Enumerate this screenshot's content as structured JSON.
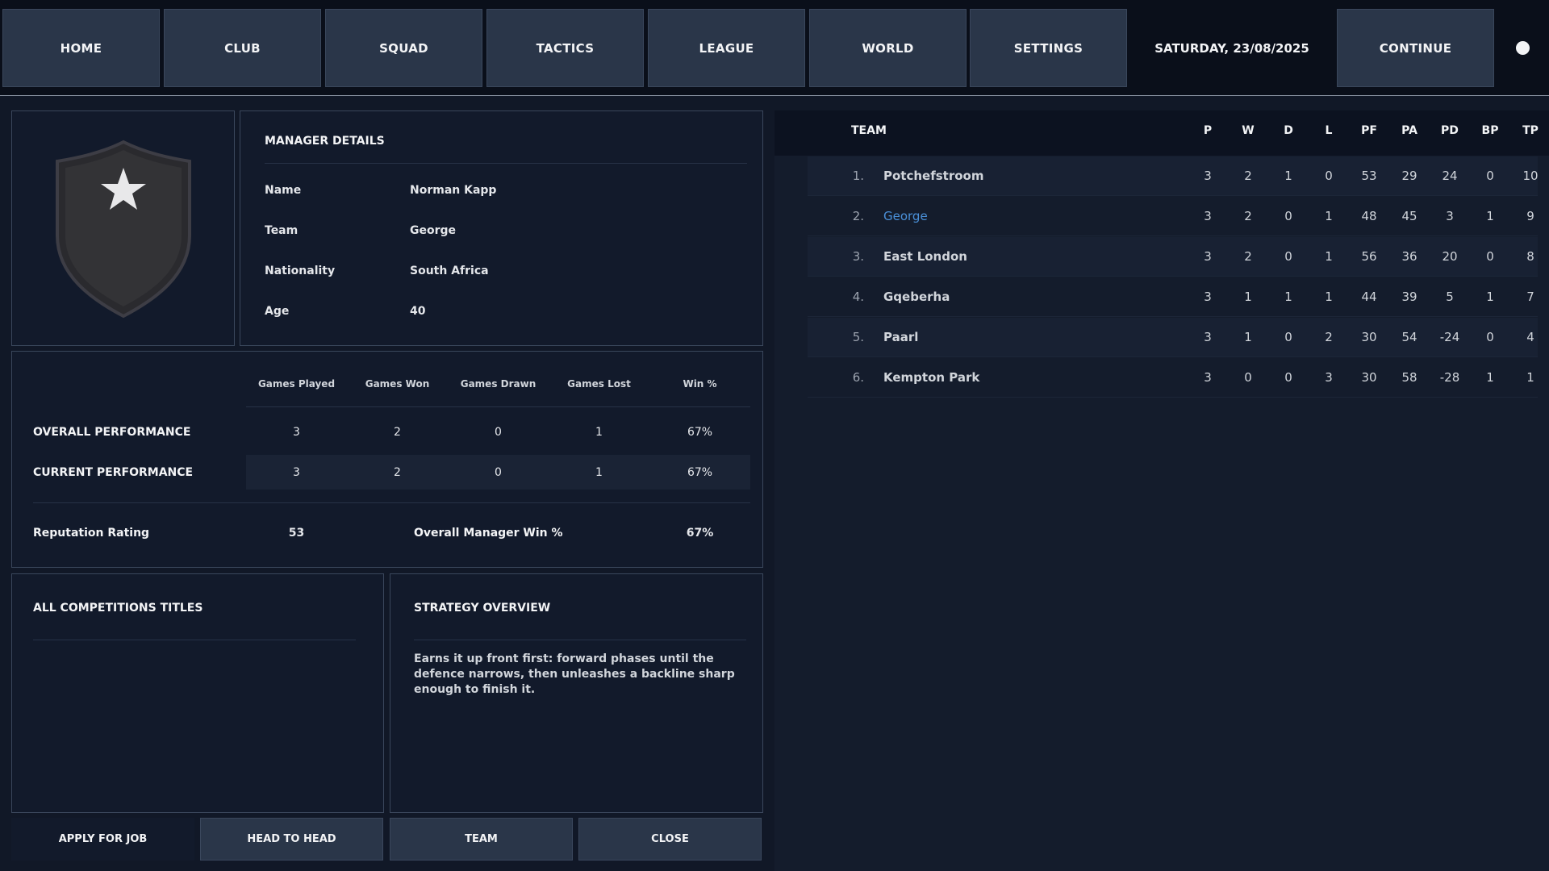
{
  "nav": {
    "items": [
      "HOME",
      "CLUB",
      "SQUAD",
      "TACTICS",
      "LEAGUE",
      "WORLD",
      "SETTINGS"
    ],
    "date": "SATURDAY, 23/08/2025",
    "continue_label": "CONTINUE"
  },
  "manager": {
    "section_title": "MANAGER DETAILS",
    "fields": [
      {
        "key": "Name",
        "value": "Norman Kapp"
      },
      {
        "key": "Team",
        "value": "George"
      },
      {
        "key": "Nationality",
        "value": "South Africa"
      },
      {
        "key": "Age",
        "value": "40"
      }
    ]
  },
  "performance": {
    "columns": [
      "Games Played",
      "Games Won",
      "Games Drawn",
      "Games Lost",
      "Win %"
    ],
    "rows": [
      {
        "label": "OVERALL PERFORMANCE",
        "values": [
          "3",
          "2",
          "0",
          "1",
          "67%"
        ]
      },
      {
        "label": "CURRENT PERFORMANCE",
        "values": [
          "3",
          "2",
          "0",
          "1",
          "67%"
        ]
      }
    ],
    "reputation_label": "Reputation Rating",
    "reputation_value": "53",
    "overall_win_label": "Overall Manager Win %",
    "overall_win_value": "67%"
  },
  "titles": {
    "section_title": "ALL COMPETITIONS TITLES"
  },
  "strategy": {
    "section_title": "STRATEGY OVERVIEW",
    "text": "Earns it up front first: forward phases until the defence narrows, then unleashes a backline sharp enough to finish it."
  },
  "bottom_buttons": {
    "apply": "APPLY FOR JOB",
    "head_to_head": "HEAD TO HEAD",
    "team": "TEAM",
    "close": "CLOSE"
  },
  "league": {
    "team_header": "TEAM",
    "columns": [
      "P",
      "W",
      "D",
      "L",
      "PF",
      "PA",
      "PD",
      "BP",
      "TP"
    ],
    "rows": [
      {
        "pos": "1.",
        "team": "Potchefstroom",
        "stats": [
          "3",
          "2",
          "1",
          "0",
          "53",
          "29",
          "24",
          "0",
          "10"
        ]
      },
      {
        "pos": "2.",
        "team": "George",
        "stats": [
          "3",
          "2",
          "0",
          "1",
          "48",
          "45",
          "3",
          "1",
          "9"
        ]
      },
      {
        "pos": "3.",
        "team": "East London",
        "stats": [
          "3",
          "2",
          "0",
          "1",
          "56",
          "36",
          "20",
          "0",
          "8"
        ]
      },
      {
        "pos": "4.",
        "team": "Gqeberha",
        "stats": [
          "3",
          "1",
          "1",
          "1",
          "44",
          "39",
          "5",
          "1",
          "7"
        ]
      },
      {
        "pos": "5.",
        "team": "Paarl",
        "stats": [
          "3",
          "1",
          "0",
          "2",
          "30",
          "54",
          "-24",
          "0",
          "4"
        ]
      },
      {
        "pos": "6.",
        "team": "Kempton Park",
        "stats": [
          "3",
          "0",
          "0",
          "3",
          "30",
          "58",
          "-28",
          "1",
          "1"
        ]
      }
    ],
    "highlight_team": "George"
  },
  "colors": {
    "background": "#111827",
    "nav_button": "#2a3649",
    "panel": "#121a2b",
    "highlight_team": "#4a90d9"
  }
}
